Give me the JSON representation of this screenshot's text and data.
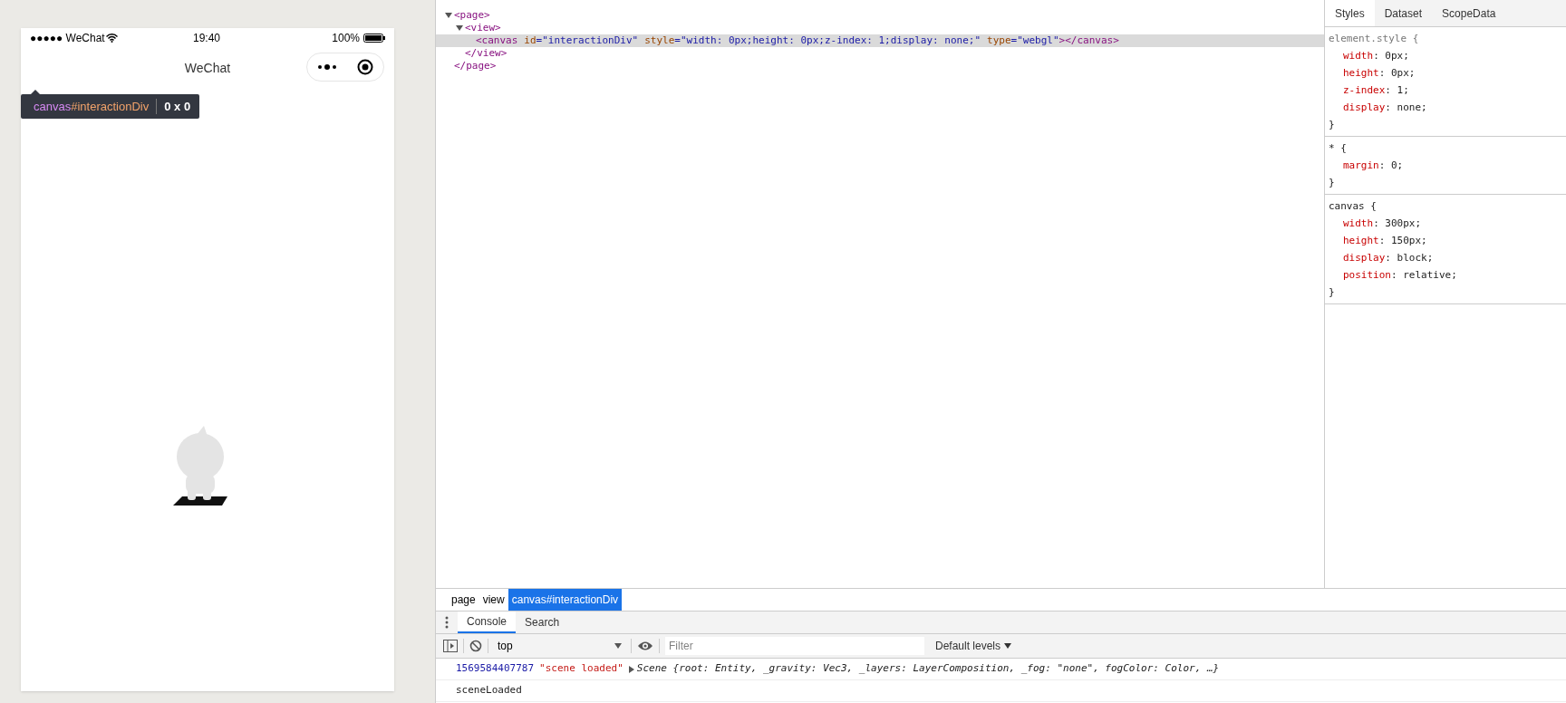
{
  "simulator": {
    "status_bar": {
      "carrier": "●●●●● WeChat",
      "time": "19:40",
      "battery": "100%"
    },
    "nav_title": "WeChat",
    "inspect_tooltip": {
      "tag": "canvas",
      "id": "#interactionDiv",
      "size": "0 x 0"
    }
  },
  "elements_tree": [
    {
      "open_tag": "<page>",
      "close_tag": "</page>",
      "expanded": true,
      "selected": false,
      "children": [
        {
          "open_tag": "<view>",
          "close_tag": "</view>",
          "expanded": true,
          "selected": false,
          "children": [
            {
              "open_tag": "<canvas",
              "attributes": [
                {
                  "name": "id",
                  "value": "=\"interactionDiv\""
                },
                {
                  "name": "style",
                  "value": "=\"width: 0px;height: 0px;z-index: 1;display: none;\""
                },
                {
                  "name": "type",
                  "value": "=\"webgl\""
                }
              ],
              "close_tag": "></canvas>",
              "selected": true
            }
          ]
        }
      ]
    }
  ],
  "styles_panel": {
    "tabs": [
      {
        "label": "Styles",
        "selected": true
      },
      {
        "label": "Dataset",
        "selected": false
      },
      {
        "label": "ScopeData",
        "selected": false
      }
    ],
    "rules": [
      {
        "selector": "element.style {",
        "properties": [
          {
            "name": "width",
            "value": ": 0px;"
          },
          {
            "name": "height",
            "value": ": 0px;"
          },
          {
            "name": "z-index",
            "value": ": 1;"
          },
          {
            "name": "display",
            "value": ": none;"
          }
        ],
        "close": "}"
      },
      {
        "selector": "* {",
        "properties": [
          {
            "name": "margin",
            "value": ": 0;"
          }
        ],
        "close": "}"
      },
      {
        "selector": "canvas {",
        "properties": [
          {
            "name": "width",
            "value": ": 300px;"
          },
          {
            "name": "height",
            "value": ": 150px;"
          },
          {
            "name": "display",
            "value": ": block;"
          },
          {
            "name": "position",
            "value": ": relative;"
          }
        ],
        "close": "}"
      }
    ]
  },
  "breadcrumb": [
    {
      "label": "page",
      "selected": false
    },
    {
      "label": "view",
      "selected": false
    },
    {
      "label": "canvas#interactionDiv",
      "selected": true
    }
  ],
  "console": {
    "tabs": [
      {
        "label": "Console",
        "selected": true
      },
      {
        "label": "Search",
        "selected": false
      }
    ],
    "context": "top",
    "filter_placeholder": "Filter",
    "levels": "Default levels",
    "messages": [
      {
        "kind": "object",
        "timestamp": "1569584407787",
        "text": "\"scene loaded\"",
        "object": "Scene {root: Entity, _gravity: Vec3, _layers: LayerComposition, _fog: \"none\", fogColor: Color, …}"
      },
      {
        "kind": "plain",
        "text": "sceneLoaded"
      }
    ]
  }
}
